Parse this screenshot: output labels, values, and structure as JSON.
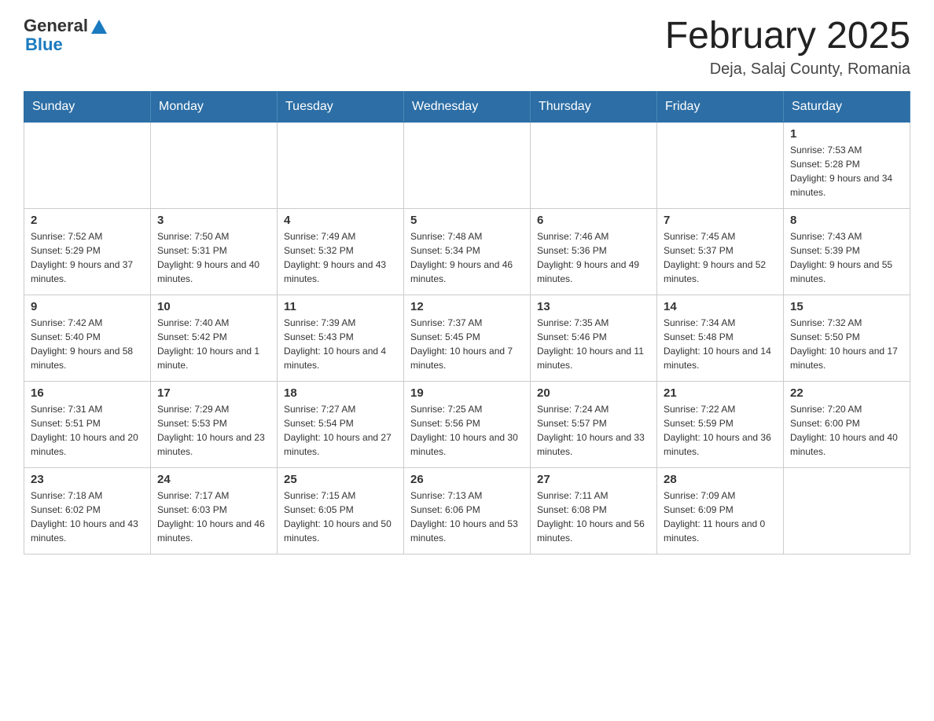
{
  "header": {
    "logo_general": "General",
    "logo_blue": "Blue",
    "title": "February 2025",
    "subtitle": "Deja, Salaj County, Romania"
  },
  "days_of_week": [
    "Sunday",
    "Monday",
    "Tuesday",
    "Wednesday",
    "Thursday",
    "Friday",
    "Saturday"
  ],
  "weeks": [
    [
      {
        "day": "",
        "info": ""
      },
      {
        "day": "",
        "info": ""
      },
      {
        "day": "",
        "info": ""
      },
      {
        "day": "",
        "info": ""
      },
      {
        "day": "",
        "info": ""
      },
      {
        "day": "",
        "info": ""
      },
      {
        "day": "1",
        "info": "Sunrise: 7:53 AM\nSunset: 5:28 PM\nDaylight: 9 hours and 34 minutes."
      }
    ],
    [
      {
        "day": "2",
        "info": "Sunrise: 7:52 AM\nSunset: 5:29 PM\nDaylight: 9 hours and 37 minutes."
      },
      {
        "day": "3",
        "info": "Sunrise: 7:50 AM\nSunset: 5:31 PM\nDaylight: 9 hours and 40 minutes."
      },
      {
        "day": "4",
        "info": "Sunrise: 7:49 AM\nSunset: 5:32 PM\nDaylight: 9 hours and 43 minutes."
      },
      {
        "day": "5",
        "info": "Sunrise: 7:48 AM\nSunset: 5:34 PM\nDaylight: 9 hours and 46 minutes."
      },
      {
        "day": "6",
        "info": "Sunrise: 7:46 AM\nSunset: 5:36 PM\nDaylight: 9 hours and 49 minutes."
      },
      {
        "day": "7",
        "info": "Sunrise: 7:45 AM\nSunset: 5:37 PM\nDaylight: 9 hours and 52 minutes."
      },
      {
        "day": "8",
        "info": "Sunrise: 7:43 AM\nSunset: 5:39 PM\nDaylight: 9 hours and 55 minutes."
      }
    ],
    [
      {
        "day": "9",
        "info": "Sunrise: 7:42 AM\nSunset: 5:40 PM\nDaylight: 9 hours and 58 minutes."
      },
      {
        "day": "10",
        "info": "Sunrise: 7:40 AM\nSunset: 5:42 PM\nDaylight: 10 hours and 1 minute."
      },
      {
        "day": "11",
        "info": "Sunrise: 7:39 AM\nSunset: 5:43 PM\nDaylight: 10 hours and 4 minutes."
      },
      {
        "day": "12",
        "info": "Sunrise: 7:37 AM\nSunset: 5:45 PM\nDaylight: 10 hours and 7 minutes."
      },
      {
        "day": "13",
        "info": "Sunrise: 7:35 AM\nSunset: 5:46 PM\nDaylight: 10 hours and 11 minutes."
      },
      {
        "day": "14",
        "info": "Sunrise: 7:34 AM\nSunset: 5:48 PM\nDaylight: 10 hours and 14 minutes."
      },
      {
        "day": "15",
        "info": "Sunrise: 7:32 AM\nSunset: 5:50 PM\nDaylight: 10 hours and 17 minutes."
      }
    ],
    [
      {
        "day": "16",
        "info": "Sunrise: 7:31 AM\nSunset: 5:51 PM\nDaylight: 10 hours and 20 minutes."
      },
      {
        "day": "17",
        "info": "Sunrise: 7:29 AM\nSunset: 5:53 PM\nDaylight: 10 hours and 23 minutes."
      },
      {
        "day": "18",
        "info": "Sunrise: 7:27 AM\nSunset: 5:54 PM\nDaylight: 10 hours and 27 minutes."
      },
      {
        "day": "19",
        "info": "Sunrise: 7:25 AM\nSunset: 5:56 PM\nDaylight: 10 hours and 30 minutes."
      },
      {
        "day": "20",
        "info": "Sunrise: 7:24 AM\nSunset: 5:57 PM\nDaylight: 10 hours and 33 minutes."
      },
      {
        "day": "21",
        "info": "Sunrise: 7:22 AM\nSunset: 5:59 PM\nDaylight: 10 hours and 36 minutes."
      },
      {
        "day": "22",
        "info": "Sunrise: 7:20 AM\nSunset: 6:00 PM\nDaylight: 10 hours and 40 minutes."
      }
    ],
    [
      {
        "day": "23",
        "info": "Sunrise: 7:18 AM\nSunset: 6:02 PM\nDaylight: 10 hours and 43 minutes."
      },
      {
        "day": "24",
        "info": "Sunrise: 7:17 AM\nSunset: 6:03 PM\nDaylight: 10 hours and 46 minutes."
      },
      {
        "day": "25",
        "info": "Sunrise: 7:15 AM\nSunset: 6:05 PM\nDaylight: 10 hours and 50 minutes."
      },
      {
        "day": "26",
        "info": "Sunrise: 7:13 AM\nSunset: 6:06 PM\nDaylight: 10 hours and 53 minutes."
      },
      {
        "day": "27",
        "info": "Sunrise: 7:11 AM\nSunset: 6:08 PM\nDaylight: 10 hours and 56 minutes."
      },
      {
        "day": "28",
        "info": "Sunrise: 7:09 AM\nSunset: 6:09 PM\nDaylight: 11 hours and 0 minutes."
      },
      {
        "day": "",
        "info": ""
      }
    ]
  ]
}
